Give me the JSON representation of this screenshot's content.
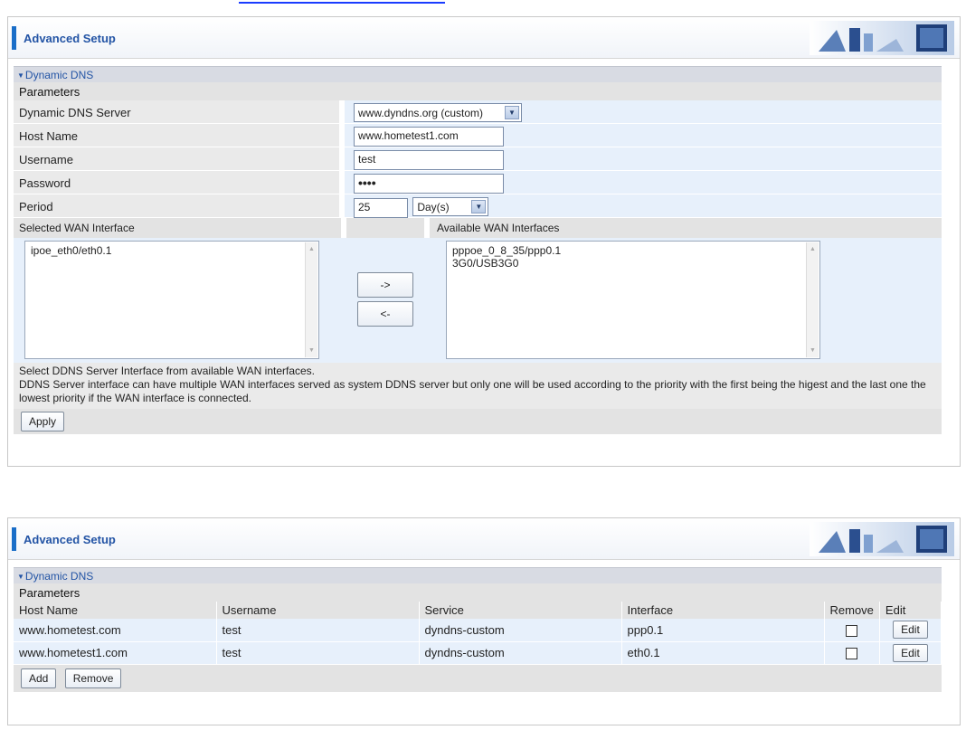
{
  "panel1": {
    "header_title": "Advanced Setup",
    "section_title": "Dynamic DNS",
    "params_label": "Parameters",
    "fields": {
      "server_label": "Dynamic DNS Server",
      "server_value": "www.dyndns.org (custom)",
      "host_label": "Host Name",
      "host_value": "www.hometest1.com",
      "user_label": "Username",
      "user_value": "test",
      "pass_label": "Password",
      "pass_value": "••••",
      "period_label": "Period",
      "period_value": "25",
      "period_unit": "Day(s)"
    },
    "wan": {
      "selected_label": "Selected WAN Interface",
      "available_label": "Available WAN Interfaces",
      "selected_items": [
        "ipoe_eth0/eth0.1"
      ],
      "available_items": [
        "pppoe_0_8_35/ppp0.1",
        "3G0/USB3G0"
      ],
      "move_right_label": "->",
      "move_left_label": "<-"
    },
    "note_line1": "Select DDNS Server Interface from available WAN interfaces.",
    "note_line2": "DDNS Server interface can have multiple WAN interfaces served as system DDNS server but only one will be used according to the priority with the first being the higest and the last one the lowest priority if the WAN interface is connected.",
    "apply_label": "Apply"
  },
  "panel2": {
    "header_title": "Advanced Setup",
    "section_title": "Dynamic DNS",
    "params_label": "Parameters",
    "columns": [
      "Host Name",
      "Username",
      "Service",
      "Interface",
      "Remove",
      "Edit"
    ],
    "rows": [
      {
        "host": "www.hometest.com",
        "user": "test",
        "service": "dyndns-custom",
        "iface": "ppp0.1",
        "edit": "Edit"
      },
      {
        "host": "www.hometest1.com",
        "user": "test",
        "service": "dyndns-custom",
        "iface": "eth0.1",
        "edit": "Edit"
      }
    ],
    "add_label": "Add",
    "remove_label": "Remove"
  },
  "colors": {
    "accent": "#1a6ec8",
    "title": "#2354a5",
    "field_bg": "#e7f0fb",
    "label_bg": "#eaeaea"
  }
}
